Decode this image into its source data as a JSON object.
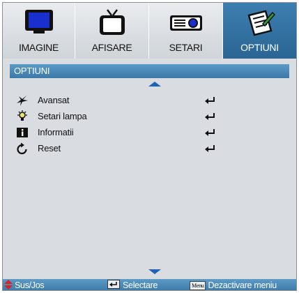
{
  "tabs": [
    {
      "label": "IMAGINE",
      "icon": "monitor-icon",
      "active": false
    },
    {
      "label": "AFISARE",
      "icon": "tv-icon",
      "active": false
    },
    {
      "label": "SETARI",
      "icon": "projector-icon",
      "active": false
    },
    {
      "label": "OPTIUNI",
      "icon": "notepad-icon",
      "active": true
    }
  ],
  "panel": {
    "title": "OPTIUNI"
  },
  "menu": [
    {
      "label": "Avansat",
      "icon": "star-icon"
    },
    {
      "label": "Setari lampa",
      "icon": "lamp-icon"
    },
    {
      "label": "Informatii",
      "icon": "info-icon"
    },
    {
      "label": "Reset",
      "icon": "reset-icon"
    }
  ],
  "status": {
    "nav_label": "Sus/Jos",
    "select_label": "Selectare",
    "menu_key": "Menu",
    "exit_label": "Dezactivare meniu"
  },
  "colors": {
    "accent": "#3a79a8",
    "arrow": "#1f62b8",
    "background": "#d9dde2"
  }
}
